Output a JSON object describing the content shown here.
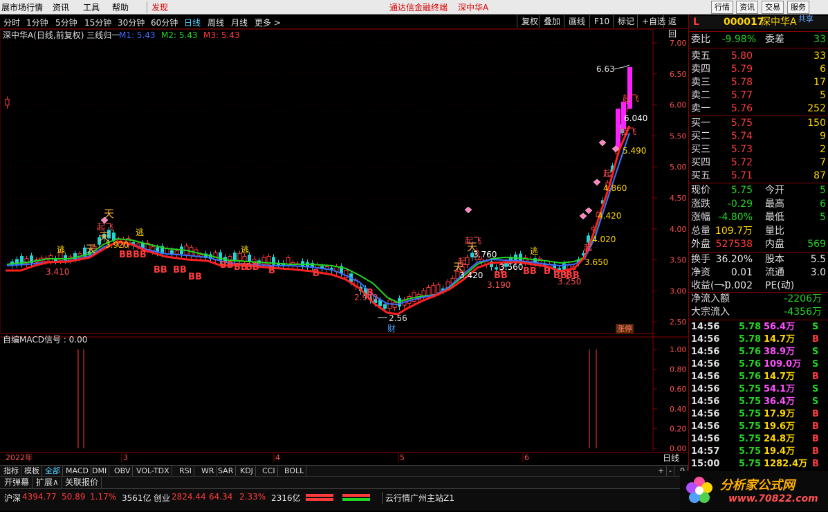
{
  "menubar": {
    "items": [
      "展市场行情",
      "资讯",
      "工具",
      "帮助"
    ],
    "discover": "发现",
    "center_title": "通达信金融终端",
    "stock_short": "深中华A",
    "right_buttons": [
      "行情",
      "资讯",
      "交易",
      "服务"
    ]
  },
  "toolbar": {
    "periods": [
      "分时",
      "1分钟",
      "5分钟",
      "15分钟",
      "30分钟",
      "60分钟",
      "日线",
      "周线",
      "月线",
      "更多 >"
    ],
    "active_period": "日线",
    "right_buttons": [
      "复权",
      "叠加",
      "画线",
      "F10",
      "标记",
      "+自选",
      "返回"
    ]
  },
  "main_chart": {
    "legend_title": "深中华A(日线,前复权) 三线归一",
    "ma": [
      {
        "label": "M1: 5.43",
        "color": "#3b6bff"
      },
      {
        "label": "M2: 5.43",
        "color": "#22d422"
      },
      {
        "label": "M3: 5.43",
        "color": "#ff3b3b"
      }
    ],
    "price_axis": [
      "7.00",
      "6.50",
      "6.00",
      "5.50",
      "5.00",
      "4.50",
      "4.00",
      "3.50",
      "3.00",
      "2.50"
    ],
    "price_labels": [
      "6.63",
      "6.040",
      "5.490",
      "4.860",
      "4.420",
      "4.020",
      "3.650",
      "3.920",
      "3.410",
      "3.420",
      "3.760",
      "3.560",
      "3.190",
      "3.250",
      "2.900",
      "2.56"
    ],
    "markers": {
      "escape": "逃",
      "heaven": "天",
      "start": "起",
      "startfly": "起飞",
      "bb": "BB",
      "b": "B",
      "fin": "财",
      "limitup": "涨停"
    }
  },
  "sub_chart": {
    "title": "自编MACD信号 : 0.00",
    "axis": [
      "1.00",
      "0.80",
      "0.60",
      "0.40",
      "0.20",
      "0.00"
    ]
  },
  "time_axis": {
    "year": "2022年",
    "months": [
      "3",
      "4",
      "5",
      "6"
    ],
    "mode": "日线"
  },
  "quote": {
    "header": {
      "marker": "L",
      "code": "000017",
      "name": "深中华A",
      "share": "共享"
    },
    "weibi": {
      "label": "委比",
      "value": "-9.98%",
      "label2": "委差",
      "value2": "33"
    },
    "asks": [
      {
        "label": "卖五",
        "price": "5.80",
        "vol": "33"
      },
      {
        "label": "卖四",
        "price": "5.79",
        "vol": "6"
      },
      {
        "label": "卖三",
        "price": "5.78",
        "vol": "17"
      },
      {
        "label": "卖二",
        "price": "5.77",
        "vol": "5"
      },
      {
        "label": "卖一",
        "price": "5.76",
        "vol": "252"
      }
    ],
    "bids": [
      {
        "label": "买一",
        "price": "5.75",
        "vol": "150"
      },
      {
        "label": "买二",
        "price": "5.74",
        "vol": "9"
      },
      {
        "label": "买三",
        "price": "5.73",
        "vol": "2"
      },
      {
        "label": "买四",
        "price": "5.72",
        "vol": "7"
      },
      {
        "label": "买五",
        "price": "5.71",
        "vol": "87"
      }
    ],
    "stats": [
      {
        "l1": "现价",
        "v1": "5.75",
        "c1": "green",
        "l2": "今开",
        "v2": "5"
      },
      {
        "l1": "涨跌",
        "v1": "-0.29",
        "c1": "green",
        "l2": "最高",
        "v2": "6"
      },
      {
        "l1": "涨幅",
        "v1": "-4.80%",
        "c1": "green",
        "l2": "最低",
        "v2": "5"
      },
      {
        "l1": "总量",
        "v1": "109.7万",
        "c1": "yellow",
        "l2": "量比",
        "v2": ""
      },
      {
        "l1": "外盘",
        "v1": "527538",
        "c1": "red",
        "l2": "内盘",
        "v2": "569"
      }
    ],
    "stats2": [
      {
        "l1": "换手",
        "v1": "36.20%",
        "c1": "white",
        "l2": "股本",
        "v2": "5.5"
      },
      {
        "l1": "净资",
        "v1": "0.01",
        "c1": "white",
        "l2": "流通",
        "v2": "3.0"
      },
      {
        "l1": "收益(一)",
        "v1": "-0.002",
        "c1": "white",
        "l2": "PE(动)",
        "v2": ""
      }
    ],
    "flow": [
      {
        "label": "净流入额",
        "value": "-2206万"
      },
      {
        "label": "大宗流入",
        "value": "-4356万"
      }
    ],
    "ticks": [
      {
        "t": "14:56",
        "p": "5.78",
        "v": "56.4万",
        "d": "S"
      },
      {
        "t": "14:56",
        "p": "5.78",
        "v": "14.7万",
        "d": "B"
      },
      {
        "t": "14:56",
        "p": "5.76",
        "v": "38.9万",
        "d": "S"
      },
      {
        "t": "14:56",
        "p": "5.76",
        "v": "109.0万",
        "d": "S"
      },
      {
        "t": "14:56",
        "p": "5.76",
        "v": "14.7万",
        "d": "B"
      },
      {
        "t": "14:56",
        "p": "5.75",
        "v": "54.1万",
        "d": "S"
      },
      {
        "t": "14:56",
        "p": "5.75",
        "v": "36.4万",
        "d": "S"
      },
      {
        "t": "14:56",
        "p": "5.75",
        "v": "17.9万",
        "d": "B"
      },
      {
        "t": "14:56",
        "p": "5.75",
        "v": "19.6万",
        "d": "B"
      },
      {
        "t": "14:56",
        "p": "5.75",
        "v": "24.8万",
        "d": "B"
      },
      {
        "t": "14:57",
        "p": "5.75",
        "v": "19.4万",
        "d": "B"
      },
      {
        "t": "15:00",
        "p": "5.75",
        "v": "1282.4万",
        "d": "B"
      }
    ]
  },
  "tabs": [
    "指标",
    "模板",
    "全部",
    "MACD",
    "DMI",
    "OBV",
    "VOL-TDX",
    "RSI",
    "WR",
    "SAR",
    "KDJ",
    "CCI",
    "BOLL"
  ],
  "active_tab": "全部",
  "tab_controls": [
    "+",
    "-",
    "0"
  ],
  "toolbar2": [
    "开弹幕",
    "扩展∧",
    "关联报价"
  ],
  "status": {
    "sh_label": "沪深",
    "sh_value": "4394.77",
    "sh_change": "50.89",
    "sh_pct": "1.17%",
    "sh_amount": "3561亿",
    "cy_label": "创业",
    "cy_value": "2824.44",
    "cy_change": "64.34",
    "cy_pct": "2.33%",
    "cy_amount": "2316亿",
    "server": "云行情广州主站Z1"
  },
  "logo": {
    "text": "分析家公式网",
    "url": "www.70822.com"
  },
  "colors": {
    "up": "#ff3b3b",
    "down": "#22d4d4",
    "bg": "#000000",
    "grid": "#8b0000",
    "magenta": "#ff00ff"
  }
}
